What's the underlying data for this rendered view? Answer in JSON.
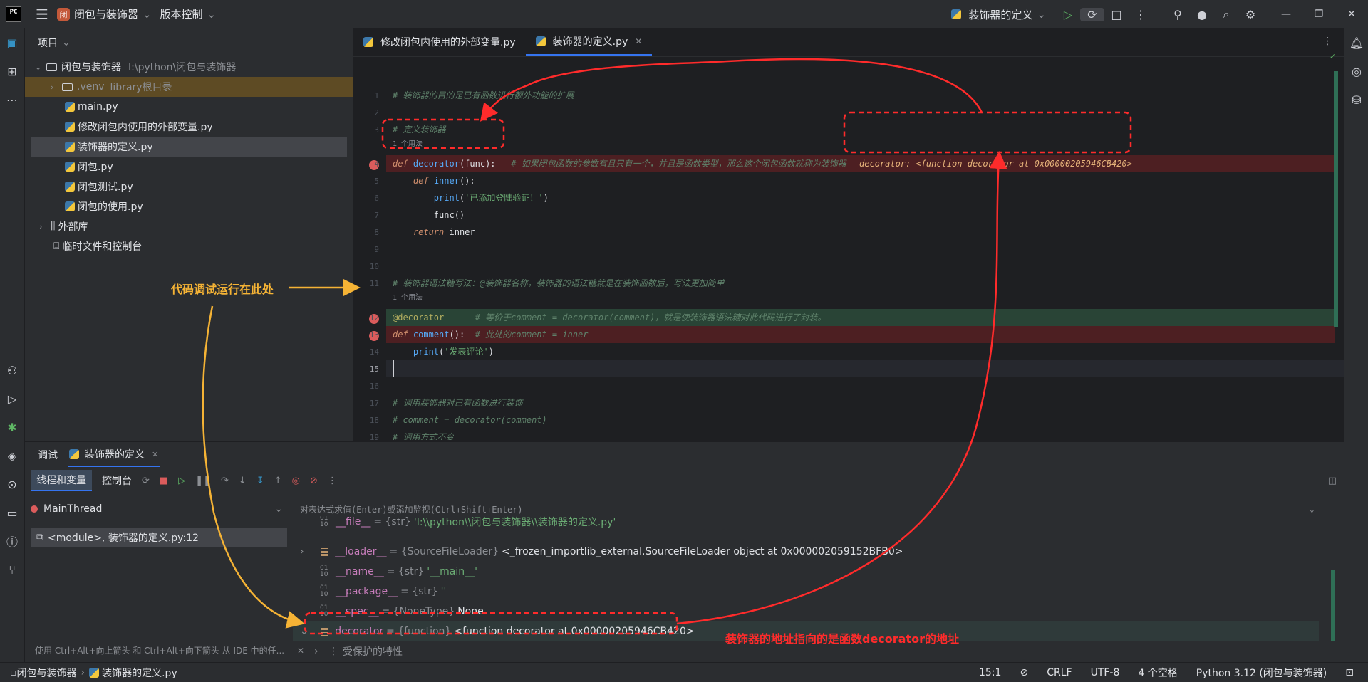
{
  "titlebar": {
    "project": "闭包与装饰器",
    "project_badge": "闭",
    "vcs": "版本控制",
    "run_config": "装饰器的定义"
  },
  "project_panel": {
    "title": "项目",
    "root": "闭包与装饰器",
    "root_path": "I:\\python\\闭包与装饰器",
    "venv": ".venv",
    "venv_note": "library根目录",
    "files": [
      "main.py",
      "修改闭包内使用的外部变量.py",
      "装饰器的定义.py",
      "闭包.py",
      "闭包测试.py",
      "闭包的使用.py"
    ],
    "external": "外部库",
    "scratches": "临时文件和控制台"
  },
  "editor": {
    "tabs": [
      "修改闭包内使用的外部变量.py",
      "装饰器的定义.py"
    ],
    "usages1": "1 个用法",
    "usages2": "1 个用法",
    "debug_inline": "decorator: <function decorator at 0x00000205946CB420>",
    "lines": {
      "l1": "# 装饰器的目的是已有函数进行额外功能的扩展",
      "l3": "# 定义装饰器",
      "l4_comment": "# 如果闭包函数的参数有且只有一个，并且是函数类型，那么这个闭包函数就称为装饰器",
      "l6_str": "'已添加登陆验证！'",
      "l11": "# 装饰器语法糖写法：@装饰器名称，装饰器的语法糖就是在装饰函数后，写法更加简单",
      "l12_comment": "# 等价于comment = decorator(comment)，就是使装饰器语法糖对此代码进行了封装。",
      "l13_comment": "# 此处的comment = inner",
      "l14_str": "'发表评论'",
      "l17": "# 调用装饰器对已有函数进行装饰",
      "l18": "# comment = decorator(comment)",
      "l20": "# 调用方式不变"
    }
  },
  "debug": {
    "tab_debug": "调试",
    "tab_config": "装饰器的定义",
    "tab_threads": "线程和变量",
    "tab_console": "控制台",
    "thread": "MainThread",
    "frame": "<module>, 装饰器的定义.py:12",
    "eval_placeholder": "对表达式求值(Enter)或添加监视(Ctrl+Shift+Enter)",
    "tip": "使用 Ctrl+Alt+向上箭头 和 Ctrl+Alt+向下箭头 从 IDE 中的任...",
    "vars": [
      {
        "name": "__file__",
        "type": "= {str}",
        "value": "'I:\\\\python\\\\闭包与装饰器\\\\装饰器的定义.py'"
      },
      {
        "name": "__loader__",
        "type": "= {SourceFileLoader}",
        "value": "<_frozen_importlib_external.SourceFileLoader object at 0x000002059152BFB0>"
      },
      {
        "name": "__name__",
        "type": "= {str}",
        "value": "'__main__'"
      },
      {
        "name": "__package__",
        "type": "= {str}",
        "value": "''"
      },
      {
        "name": "__spec__",
        "type": "= {NoneType}",
        "value": "None"
      },
      {
        "name": "decorator",
        "type": "= {function}",
        "value": "<function decorator at 0x00000205946CB420>"
      },
      {
        "name": "",
        "type": "",
        "value": "受保护的特性"
      }
    ]
  },
  "statusbar": {
    "breadcrumb_project": "闭包与装饰器",
    "breadcrumb_file": "装饰器的定义.py",
    "pos": "15:1",
    "eol": "CRLF",
    "enc": "UTF-8",
    "indent": "4 个空格",
    "interpreter": "Python 3.12 (闭包与装饰器)"
  },
  "annotations": {
    "yellow": "代码调试运行在此处",
    "red": "装饰器的地址指向的是函数decorator的地址"
  },
  "colors": {
    "accent": "#3574f0",
    "annot_red": "#ff2b2b",
    "annot_yellow": "#f5b335"
  }
}
